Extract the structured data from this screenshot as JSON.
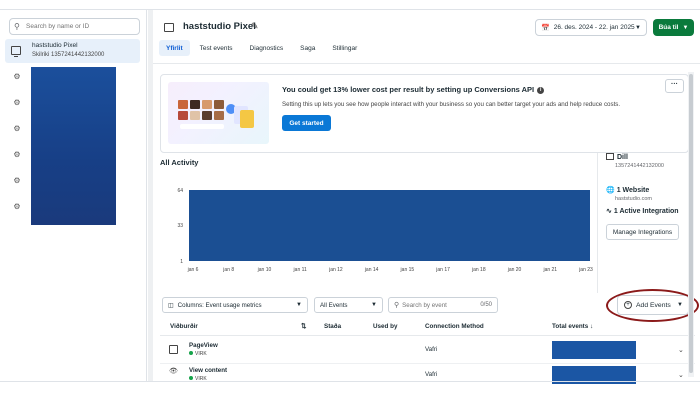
{
  "sidebar": {
    "search_placeholder": "Search by name or ID",
    "pixel_name": "haststudio Pixel",
    "pixel_id": "Skilriki 1357241442132000"
  },
  "header": {
    "title": "haststudio Pixel",
    "date_range": "26. des. 2024 - 22. jan 2025",
    "create_button": "Búa til"
  },
  "tabs": [
    "Yfirlit",
    "Test events",
    "Diagnostics",
    "Saga",
    "Stillingar"
  ],
  "promo": {
    "title": "You could get 13% lower cost per result by setting up Conversions API",
    "text": "Setting this up lets you see how people interact with your business so you can better target your ads and help reduce costs.",
    "button": "Get started",
    "more": "···"
  },
  "activity": {
    "label": "All Activity"
  },
  "info": {
    "pixel_name": "Dill",
    "pixel_id": "1357241442132000",
    "website_title": "1 Website",
    "website_url": "haststudio.com",
    "integration_title": "1 Active Integration",
    "manage_button": "Manage Integrations"
  },
  "filters": {
    "columns": "Columns: Event usage metrics",
    "events": "All Events",
    "search_placeholder": "Search by event",
    "search_count": "0/50",
    "add_events": "Add Events"
  },
  "table": {
    "headers": [
      "Viðburðir",
      "Staða",
      "Used by",
      "Connection Method",
      "Total events ↓"
    ],
    "rows": [
      {
        "name": "PageView",
        "status": "VIRK",
        "method": "Vafri"
      },
      {
        "name": "View content",
        "status": "VIRK",
        "method": "Vafri"
      }
    ]
  },
  "chart_data": {
    "type": "area",
    "title": "All Activity",
    "categories": [
      "jan 6",
      "jan 8",
      "jan 10",
      "jan 11",
      "jan 12",
      "jan 14",
      "jan 15",
      "jan 17",
      "jan 18",
      "jan 20",
      "jan 21",
      "jan 23"
    ],
    "y_ticks": [
      "1",
      "33",
      "64"
    ],
    "ylim": [
      1,
      64
    ],
    "series": [
      {
        "values": [
          64,
          64,
          64,
          64,
          64,
          64,
          64,
          64,
          64,
          64,
          64,
          64
        ]
      }
    ],
    "fill_color": "#1b4f93",
    "grid": false
  },
  "colors": {
    "primary": "#0a78d6",
    "create": "#0a7a3c",
    "active_tab_bg": "#e7f0fa",
    "status_green": "#16a34a",
    "annotation_oval": "#8b1a1a"
  }
}
